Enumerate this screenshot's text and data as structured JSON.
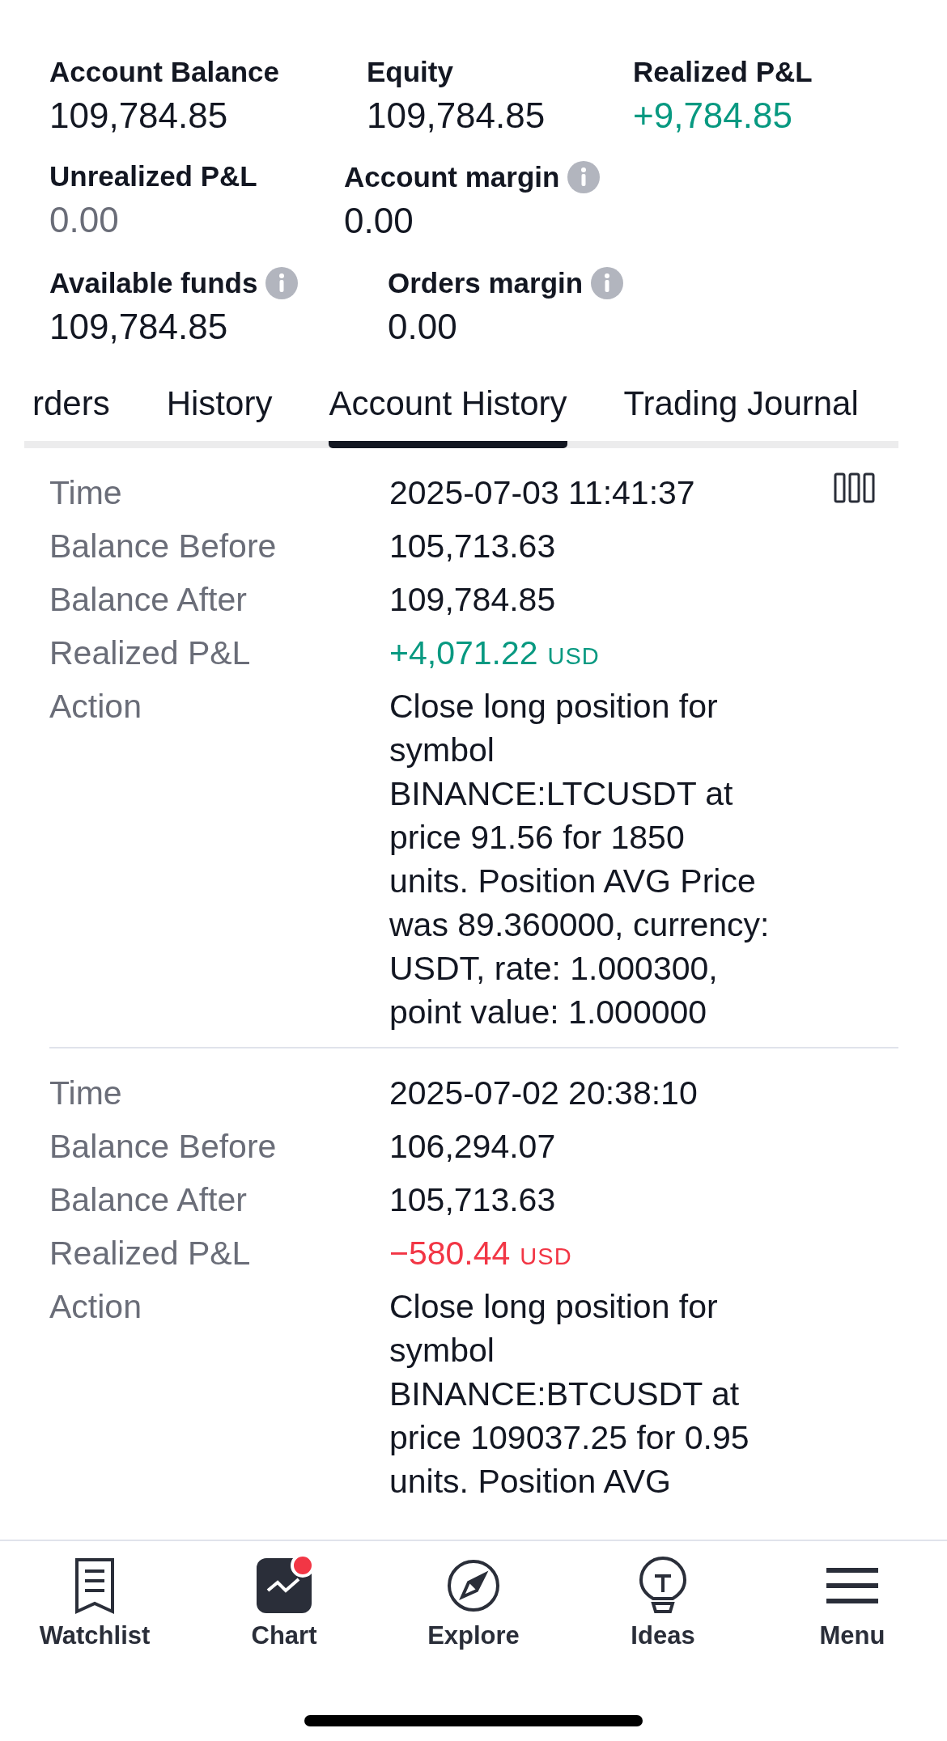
{
  "summary": [
    [
      {
        "label": "Account Balance",
        "value": "109,784.85",
        "color": "#131722",
        "info": false
      },
      {
        "label": "Equity",
        "value": "109,784.85",
        "color": "#131722",
        "info": false
      },
      {
        "label": "Realized P&L",
        "value": "+9,784.85",
        "color": "#089981",
        "info": false
      }
    ],
    [
      {
        "label": "Unrealized P&L",
        "value": "0.00",
        "color": "#6a6d78",
        "info": false
      },
      {
        "label": "Account margin",
        "value": "0.00",
        "color": "#131722",
        "info": true
      }
    ],
    [
      {
        "label": "Available funds",
        "value": "109,784.85",
        "color": "#131722",
        "info": true
      },
      {
        "label": "Orders margin",
        "value": "0.00",
        "color": "#131722",
        "info": true
      }
    ]
  ],
  "tabs": [
    {
      "label": "rders",
      "selected": false
    },
    {
      "label": "History",
      "selected": false
    },
    {
      "label": "Account History",
      "selected": true
    },
    {
      "label": "Trading Journal",
      "selected": false
    }
  ],
  "entries": [
    {
      "columns_button": true,
      "fields": [
        {
          "label": "Time",
          "value": "2025-07-03 11:41:37",
          "color": "#131722"
        },
        {
          "label": "Balance Before",
          "value": "105,713.63",
          "color": "#131722"
        },
        {
          "label": "Balance After",
          "value": "109,784.85",
          "color": "#131722"
        },
        {
          "label": "Realized P&L",
          "value": "+4,071.22",
          "unit": "USD",
          "color": "#089981"
        },
        {
          "label": "Action",
          "value": "Close long position for symbol BINANCE:LTCUSDT at price 91.56 for 1850 units. Position AVG Price was 89.360000, currency: USDT, rate: 1.000300, point value: 1.000000",
          "color": "#131722"
        }
      ]
    },
    {
      "columns_button": false,
      "fields": [
        {
          "label": "Time",
          "value": "2025-07-02 20:38:10",
          "color": "#131722"
        },
        {
          "label": "Balance Before",
          "value": "106,294.07",
          "color": "#131722"
        },
        {
          "label": "Balance After",
          "value": "105,713.63",
          "color": "#131722"
        },
        {
          "label": "Realized P&L",
          "value": "−580.44",
          "unit": "USD",
          "color": "#f23645"
        },
        {
          "label": "Action",
          "value": "Close long position for symbol BINANCE:BTCUSDT at price 109037.25 for 0.95 units. Position AVG",
          "color": "#131722"
        }
      ]
    }
  ],
  "nav": [
    {
      "label": "Watchlist",
      "badge": false
    },
    {
      "label": "Chart",
      "badge": true
    },
    {
      "label": "Explore",
      "badge": false
    },
    {
      "label": "Ideas",
      "badge": false
    },
    {
      "label": "Menu",
      "badge": false
    }
  ]
}
